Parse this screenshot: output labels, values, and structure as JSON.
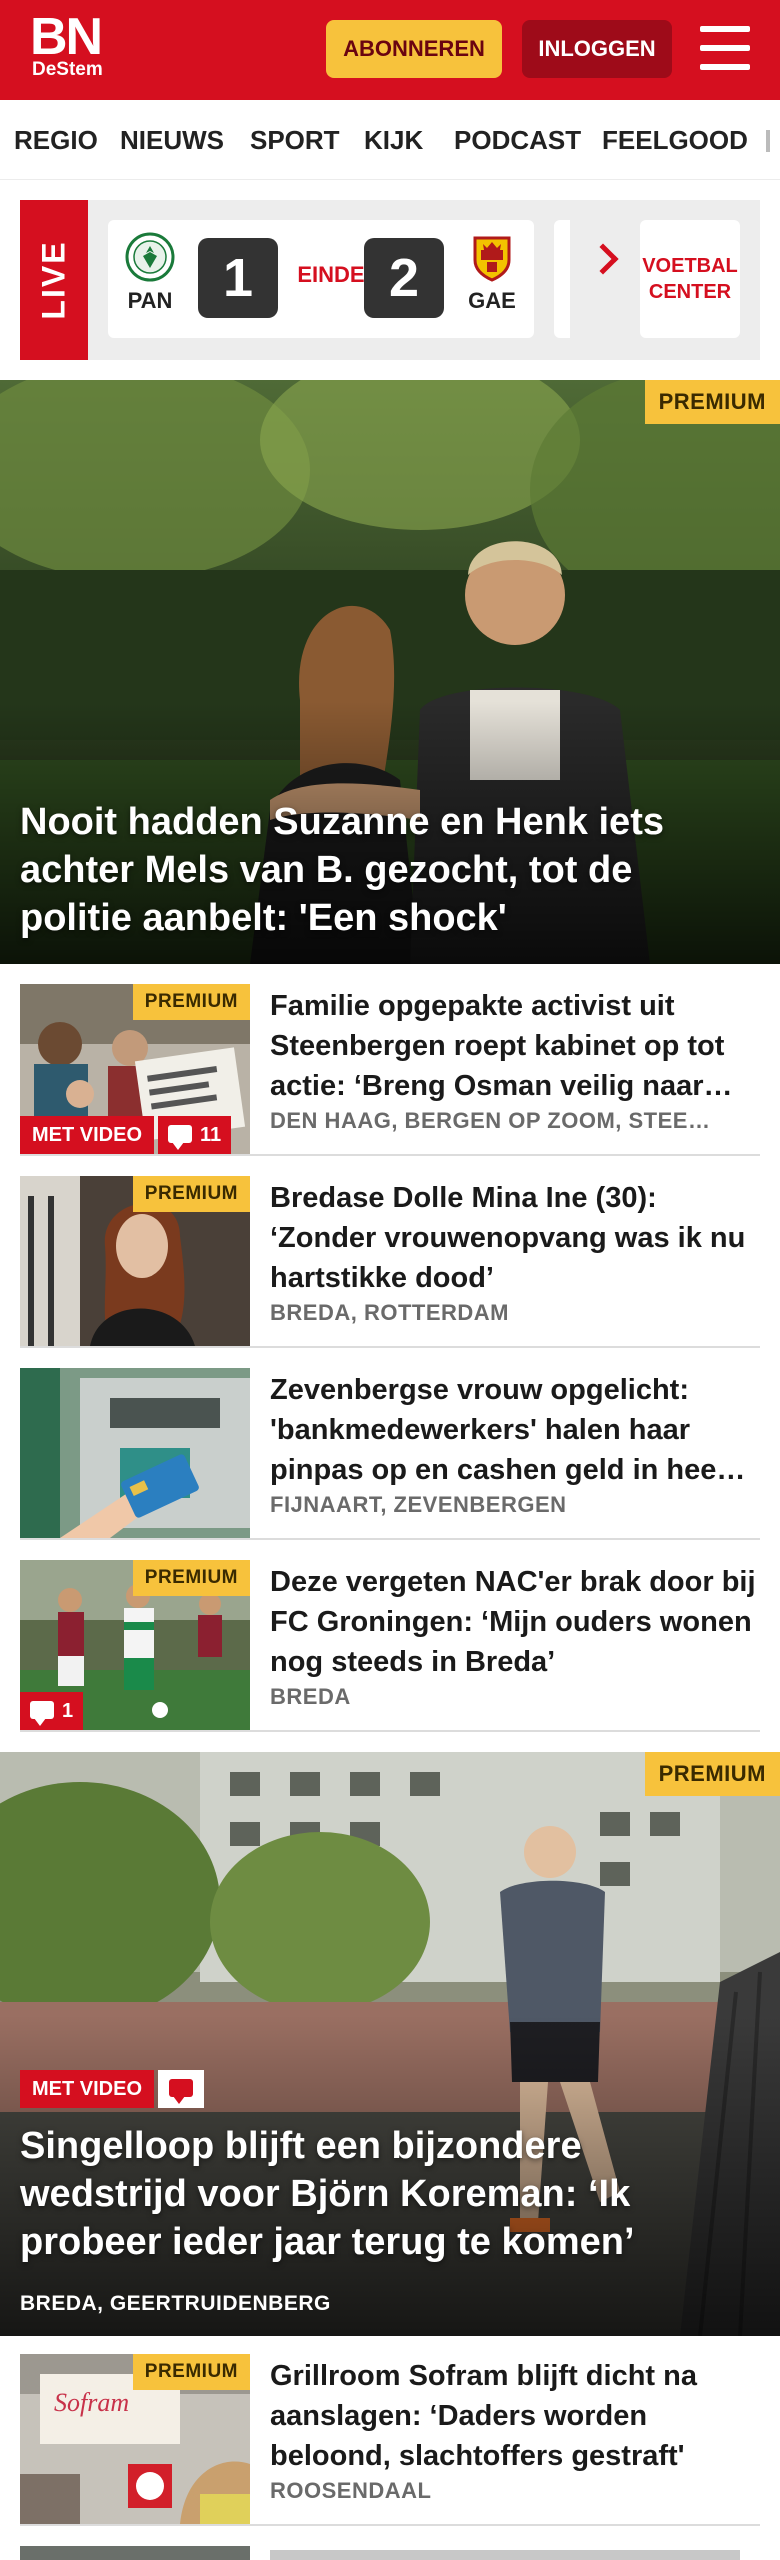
{
  "header": {
    "logo_main": "BN",
    "logo_sub": "DeStem",
    "subscribe_label": "ABONNEREN",
    "login_label": "INLOGGEN",
    "menu_icon": "hamburger-menu-icon",
    "brand_color": "#d50f1f",
    "subscribe_color": "#f7c23c"
  },
  "nav": {
    "items": [
      "REGIO",
      "NIEUWS",
      "SPORT",
      "KIJK",
      "PODCAST",
      "FEELGOOD"
    ]
  },
  "live": {
    "label": "LIVE",
    "home_team": "PAN",
    "home_score": "1",
    "status": "EINDE",
    "away_score": "2",
    "away_team": "GAE",
    "next_icon": "chevron-right-icon",
    "center_label": "VOETBAL CENTER"
  },
  "premium_label": "PREMIUM",
  "video_label": "MET VIDEO",
  "hero1": {
    "title": "Nooit hadden Suzanne en Henk iets achter Mels van B. gezocht, tot de politie aanbelt: 'Een shock'"
  },
  "articles": [
    {
      "title": "Familie opgepakte activist uit Steenbergen roept kabinet op tot actie: ‘Breng Osman veilig naar…",
      "location": "DEN HAAG, BERGEN OP ZOOM, STEE…",
      "comments": "11"
    },
    {
      "title": "Bredase Dolle Mina Ine (30): ‘Zonder vrouwenopvang was ik nu hartstikke dood’",
      "location": "BREDA, ROTTERDAM"
    },
    {
      "title": "Zevenbergse vrouw opgelicht: 'bankmedewerkers' halen haar pinpas op en cashen geld in hee…",
      "location": "FIJNAART, ZEVENBERGEN"
    },
    {
      "title": "Deze vergeten NAC'er brak door bij FC Groningen: ‘Mijn ouders wonen nog steeds in Breda’",
      "location": "BREDA",
      "comments": "1"
    },
    {
      "title": "Grillroom Sofram blijft dicht na aanslagen: ‘Daders worden beloond, slachtoffers gestraft'",
      "location": "ROOSENDAAL",
      "sign_text": "Sofram"
    }
  ],
  "hero2": {
    "title": "Singelloop blijft een bijzondere wedstrijd voor Björn Koreman: ‘Ik probeer ieder jaar terug te komen’",
    "location": "BREDA, GEERTRUIDENBERG"
  }
}
